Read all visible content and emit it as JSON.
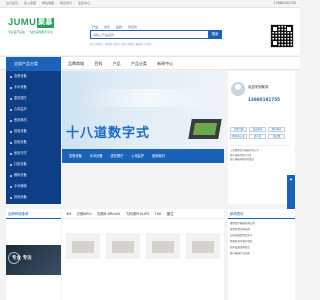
{
  "topbar": {
    "links": [
      "设为首页",
      "加入收藏",
      "网站地图",
      "联系我们",
      "会员中心"
    ],
    "phone": "13980191755"
  },
  "logo": {
    "text": "JUMU",
    "badge": "聚慕",
    "tagline": "专业医疗设备 · 一站式采购服务平台"
  },
  "search": {
    "tabs": [
      "产品",
      "资讯",
      "品牌",
      "供应商"
    ],
    "active_tab": 0,
    "placeholder": "请输入产品名称",
    "button": "搜索",
    "hotwords": "热门关键词：呼吸机 监护仪 超声 除颤仪 输液泵 注射泵"
  },
  "nav": {
    "category_button": "全部产品分类",
    "items": [
      "品牌商城",
      "百科",
      "产品",
      "产品分类",
      "新闻中心"
    ]
  },
  "categories": [
    "急救设备",
    "手术设备",
    "康复理疗",
    "心电监护",
    "医用耗材",
    "检验设备",
    "影像设备",
    "医用光学",
    "口腔设备",
    "眼科设备",
    "手术器械",
    "其他设备"
  ],
  "banner": {
    "headline": "十八道数字式"
  },
  "quick_links": [
    "急救设备",
    "手术设备",
    "康复理疗",
    "心电监护",
    "医用耗材"
  ],
  "login": {
    "welcome": "欢迎来到聚慕",
    "hotline": "13980191755",
    "buttons": [
      "立即注册",
      "会员登录",
      "发布询价",
      "供应商入驻",
      "找产品",
      "找品牌"
    ],
    "notices": [
      "上海聚慕医疗器械有限公司",
      "医疗器械经营许可证",
      "医疗器械网络销售备案"
    ]
  },
  "brand_section": {
    "title": "品牌商城推荐",
    "tabs": [
      "3M",
      "贝朗ARO",
      "贝朗B.BRAUN",
      "飞利浦PHILIPS",
      "TSK",
      "捷生"
    ]
  },
  "promo": {
    "text": "专业 专注"
  },
  "news": {
    "title": "新闻资讯",
    "items": [
      "聚慕医疗器械有限公司",
      "医用耗材采购指南",
      "如何选择医用监护仪",
      "呼吸机日常维护保养",
      "超声设备选购要点",
      "医疗器械行业动态"
    ]
  }
}
